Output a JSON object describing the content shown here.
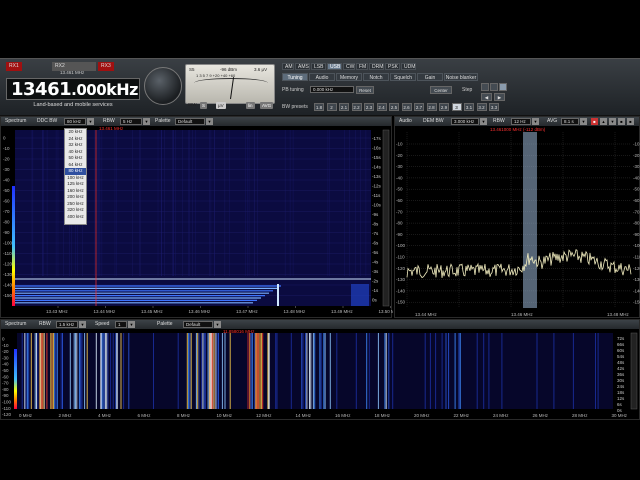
{
  "header": {
    "rx_tabs": [
      "RX1",
      "RX2",
      "RX3"
    ],
    "rx2_sub": "13.461 MHz",
    "frequency_main": "13461",
    "frequency_small": ".000",
    "frequency_unit": "kHz",
    "band_label": "Land-based and mobile services"
  },
  "meter": {
    "s_label": "S5",
    "dbm_value": "-96 dBm",
    "uv_value": "3.6 μV",
    "scale_labels": "1 3 5 7 9 +20 +40 +60",
    "ibw_label": "IBW",
    "s_btn": "S",
    "uv_btn": "μV",
    "lin_btn": "lin",
    "avg_btn": "AVG"
  },
  "modes": [
    "AM",
    "AMS",
    "LSB",
    "USB",
    "CW",
    "FM",
    "DRM",
    "PSK",
    "UDM"
  ],
  "active_mode": "USB",
  "tabs": [
    "Tuning",
    "Audio",
    "Memory",
    "Notch",
    "Squelch",
    "Gain",
    "Noise blanker"
  ],
  "active_tab": "Tuning",
  "tuning": {
    "pb_label": "PB tuning",
    "pb_value": "0.000 kHz",
    "reset_label": "Reset",
    "center_label": "Center",
    "step_label": "Step",
    "bw_presets_label": "BW presets",
    "presets": [
      "1.8",
      "2",
      "2.1",
      "2.2",
      "2.3",
      "2.4",
      "2.5",
      "2.6",
      "2.7",
      "2.8",
      "2.9",
      "3",
      "3.1",
      "3.2",
      "3.3"
    ],
    "active_preset": "3"
  },
  "spectrum": {
    "title": "Spectrum",
    "ddc_bw_label": "DDC BW",
    "ddc_bw_value": "80 kHz",
    "rbw_label": "RBW",
    "rbw_value": "5 Hz",
    "palette_label": "Palette",
    "palette_value": "Default",
    "cursor_freq": "13.461 MHz",
    "y_labels": [
      "0",
      "-10",
      "-20",
      "-30",
      "-40",
      "-50",
      "-60",
      "-70",
      "-80",
      "-90",
      "-100",
      "-110",
      "-120",
      "-130",
      "-140",
      "-150"
    ],
    "x_labels": [
      "13.43 MHz",
      "13.44 MHz",
      "13.45 MHz",
      "13.46 MHz",
      "13.47 MHz",
      "13.48 MHz",
      "13.49 MHz",
      "13.50 MHz"
    ],
    "time_labels": [
      "-17s",
      "-16s",
      "-15s",
      "-14s",
      "-13s",
      "-12s",
      "-11s",
      "-10s",
      "-9s",
      "-8s",
      "-7s",
      "-6s",
      "-5s",
      "-4s",
      "-3s",
      "-2s",
      "-1s",
      "0s"
    ],
    "ddc_options": [
      "20 kHz",
      "24 kHz",
      "32 kHz",
      "40 kHz",
      "50 kHz",
      "64 kHz",
      "80 kHz",
      "100 kHz",
      "125 kHz",
      "160 kHz",
      "200 kHz",
      "250 kHz",
      "320 kHz",
      "400 kHz"
    ],
    "ddc_selected": "80 kHz"
  },
  "audio": {
    "title": "Audio",
    "dem_bw_label": "DEM BW",
    "dem_bw_value": "3.000 kHz",
    "rbw_label": "RBW",
    "rbw_value": "12 Hz",
    "avg_label": "AVG",
    "avg_value": "8.1 s",
    "cursor_readout": "13.461000 MHz (-112 dBm)",
    "y_labels": [
      "-10",
      "-20",
      "-30",
      "-40",
      "-50",
      "-60",
      "-70",
      "-80",
      "-90",
      "-100",
      "-110",
      "-120",
      "-130",
      "-140",
      "-150"
    ],
    "x_labels": [
      "13.44 MHz",
      "13.46 MHz",
      "13.48 MHz"
    ]
  },
  "wide": {
    "title": "Spectrum",
    "rbw_label": "RBW",
    "rbw_value": "1.5 kHz",
    "speed_label": "Speed",
    "speed_value": "1",
    "palette_label": "Palette",
    "palette_value": "Default",
    "cursor_freq": "11.858016 MHz",
    "y_labels": [
      "0",
      "-10",
      "-20",
      "-30",
      "-40",
      "-50",
      "-60",
      "-70",
      "-80",
      "-90",
      "-100",
      "-110",
      "-120"
    ],
    "x_labels": [
      "0 MHz",
      "2 MHz",
      "4 MHz",
      "6 MHz",
      "8 MHz",
      "10 MHz",
      "12 MHz",
      "14 MHz",
      "16 MHz",
      "18 MHz",
      "20 MHz",
      "22 MHz",
      "24 MHz",
      "26 MHz",
      "28 MHz",
      "30 MHz"
    ],
    "time_labels": [
      "72s",
      "66s",
      "60s",
      "54s",
      "48s",
      "42s",
      "36s",
      "30s",
      "24s",
      "18s",
      "12s",
      "6s",
      "0s"
    ]
  },
  "colors": {
    "accent": "#6b7d90",
    "trace": "#f3eec0",
    "passband": "#9ab6d6",
    "cursor_red": "#ff3030",
    "waterfall_bg": "#0a0a3a"
  }
}
